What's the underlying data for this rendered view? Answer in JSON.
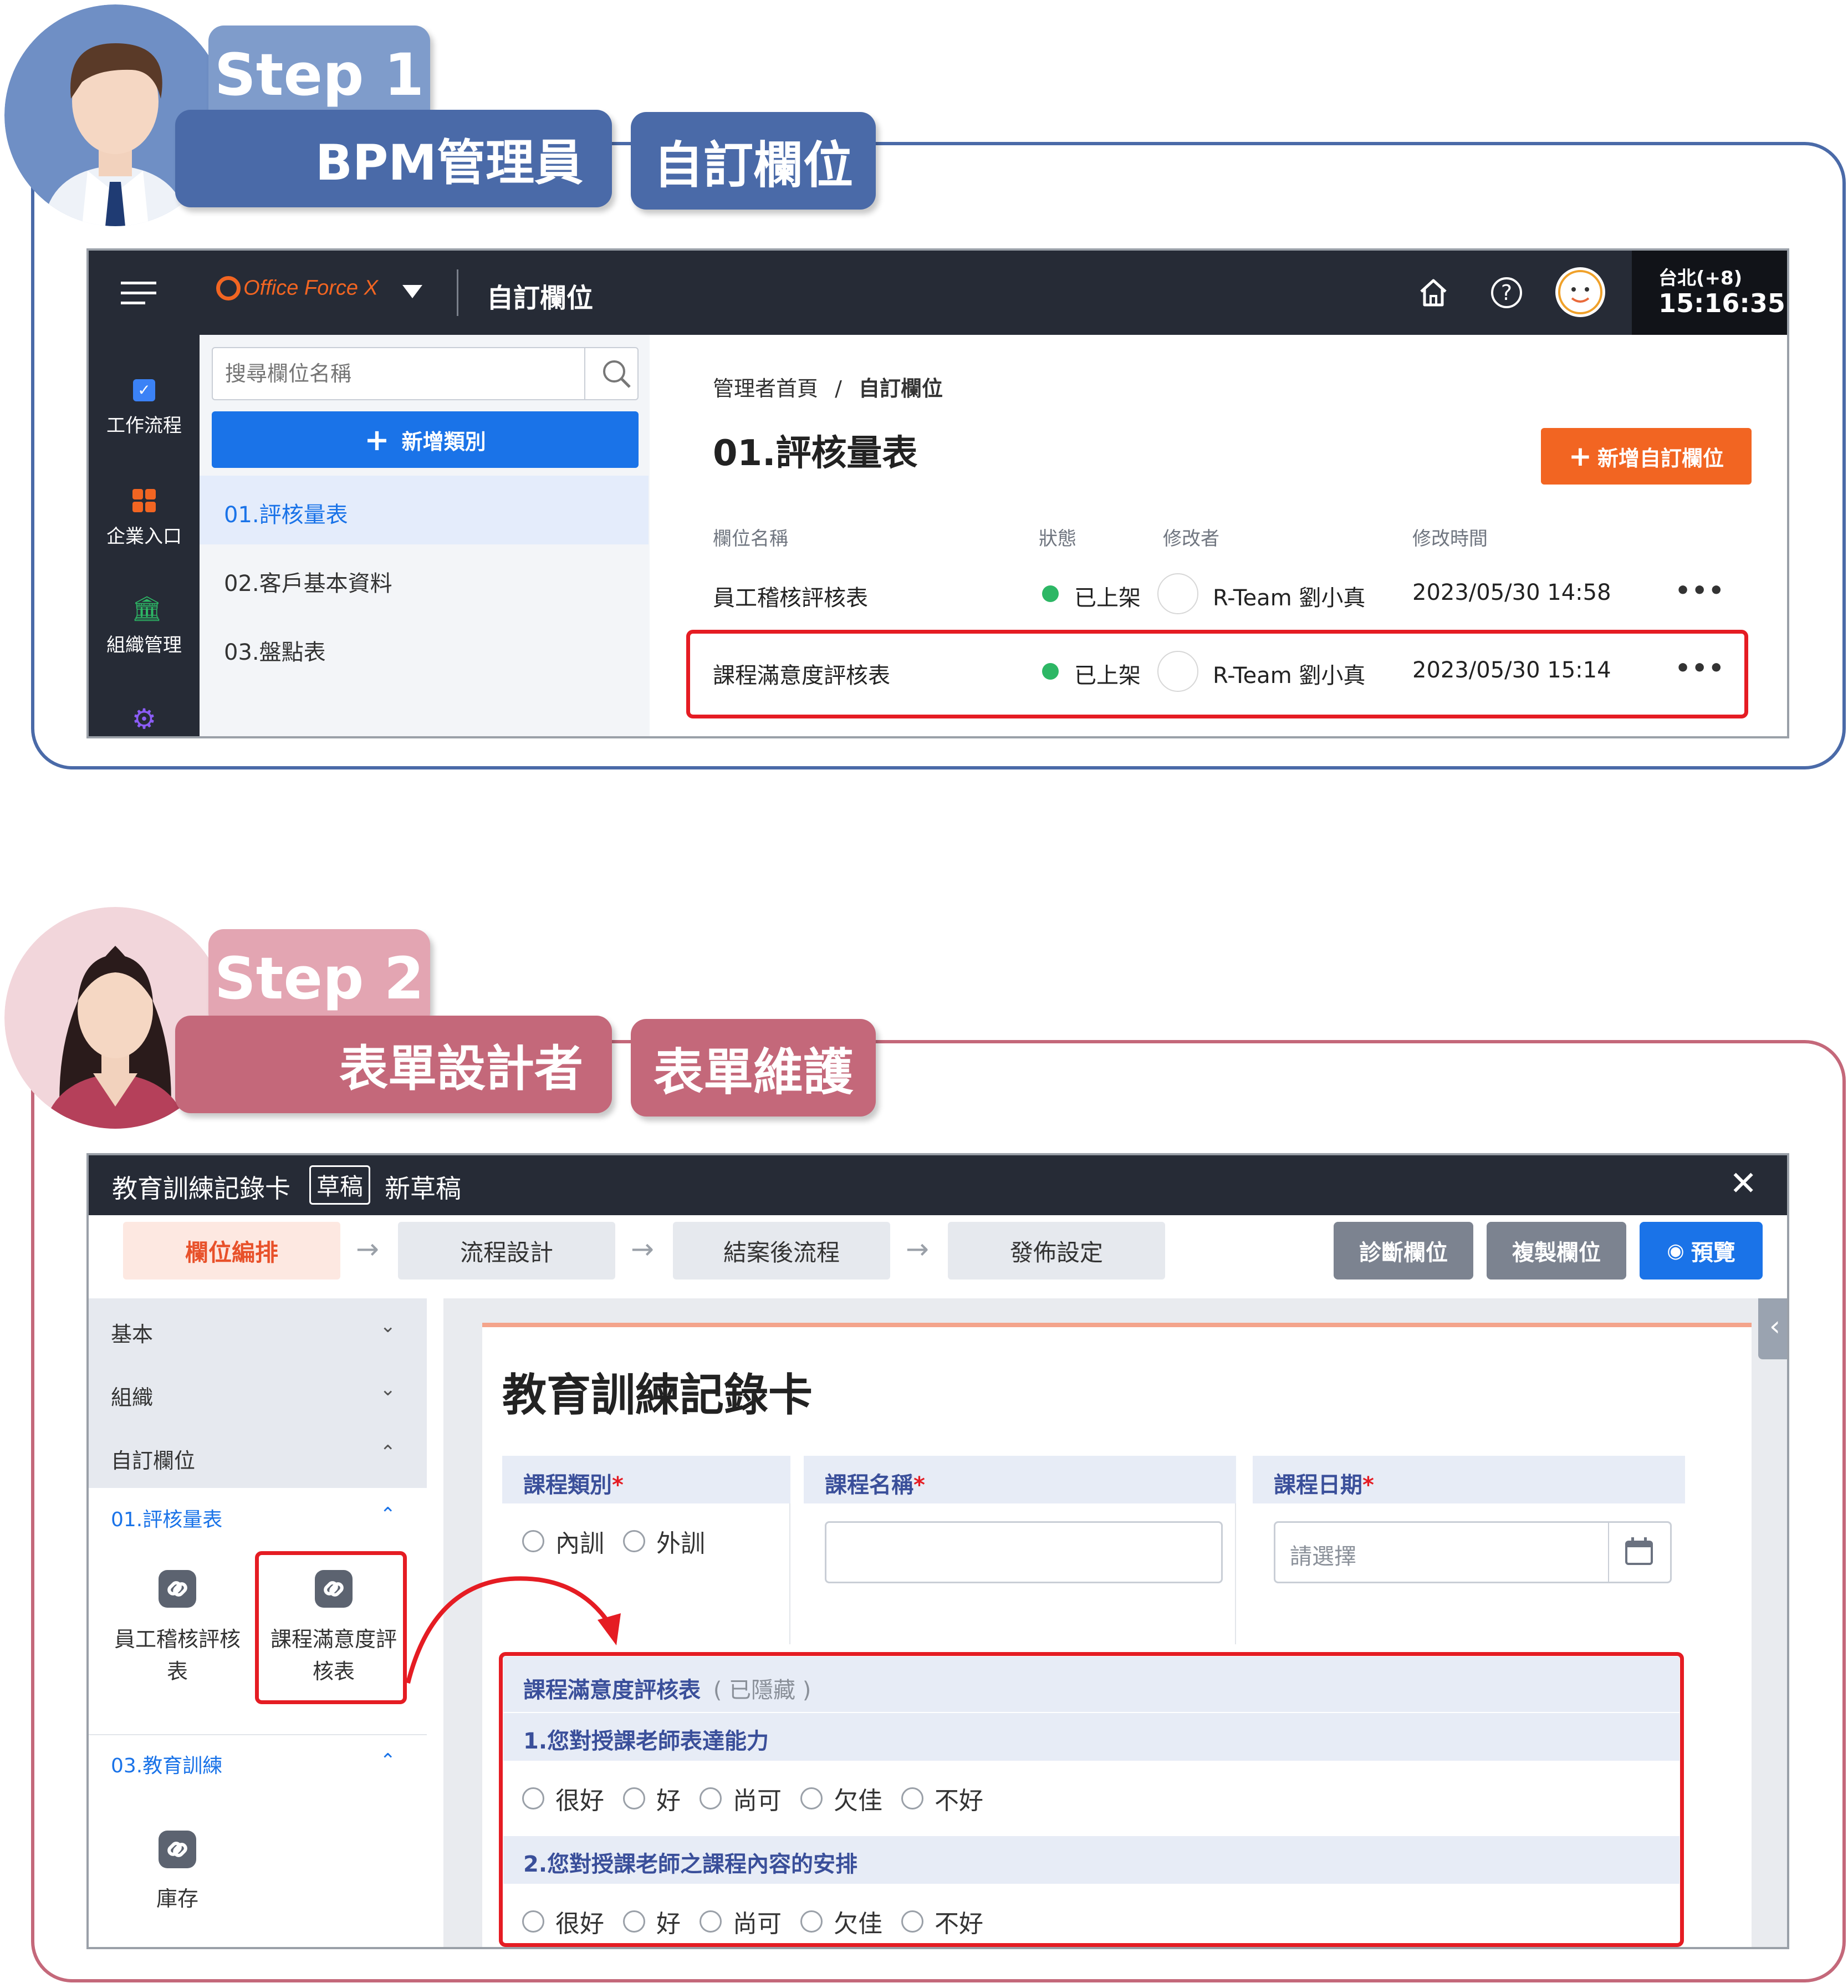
{
  "colors": {
    "step1": "#4a6aa8",
    "step1_light": "#7f9ccb",
    "step2": "#c4687a",
    "step2_light": "#e3a5b2",
    "accent_orange": "#f26522",
    "accent_blue": "#1a73e8",
    "highlight_red": "#e51c23"
  },
  "step1": {
    "step_label": "Step 1",
    "role": "BPM管理員",
    "feature": "自訂欄位",
    "app": {
      "logo_text": "Office Force X",
      "page_title": "自訂欄位",
      "timezone": "台北(+8)",
      "time": "15:16:35",
      "icons": [
        "menu-icon",
        "home-icon",
        "help-icon",
        "user-avatar"
      ],
      "sidebar": [
        {
          "label": "工作流程",
          "icon": "workflow-icon"
        },
        {
          "label": "企業入口",
          "icon": "portal-icon"
        },
        {
          "label": "組織管理",
          "icon": "org-icon"
        },
        {
          "label": "",
          "icon": "settings-icon"
        }
      ],
      "search_placeholder": "搜尋欄位名稱",
      "add_category": "新增類別",
      "categories": [
        "01.評核量表",
        "02.客戶基本資料",
        "03.盤點表"
      ],
      "breadcrumb": [
        "管理者首頁",
        "自訂欄位"
      ],
      "breadcrumb_sep": "/",
      "heading": "01.評核量表",
      "add_field_button": "新增自訂欄位",
      "table": {
        "headers": [
          "欄位名稱",
          "狀態",
          "修改者",
          "修改時間"
        ],
        "rows": [
          {
            "name": "員工稽核評核表",
            "status": "已上架",
            "editor": "R-Team 劉小真",
            "time": "2023/05/30 14:58",
            "more": "•••"
          },
          {
            "name": "課程滿意度評核表",
            "status": "已上架",
            "editor": "R-Team 劉小真",
            "time": "2023/05/30 15:14",
            "more": "•••"
          }
        ]
      }
    }
  },
  "step2": {
    "step_label": "Step 2",
    "role": "表單設計者",
    "feature": "表單維護",
    "app": {
      "form_name": "教育訓練記錄卡",
      "draft_badge": "草稿",
      "draft_name": "新草稿",
      "close": "✕",
      "steps": [
        "欄位編排",
        "流程設計",
        "結案後流程",
        "發佈設定"
      ],
      "step_arrow": "→",
      "tool_buttons": [
        "診斷欄位",
        "複製欄位",
        "預覽"
      ],
      "collapse_icon": "‹",
      "accordion": [
        "基本",
        "組織",
        "自訂欄位"
      ],
      "groups": [
        {
          "label": "01.評核量表",
          "items": [
            "員工稽核評核表",
            "課程滿意度評核表"
          ]
        },
        {
          "label": "03.教育訓練",
          "items": [
            "庫存"
          ]
        }
      ],
      "form": {
        "title": "教育訓練記錄卡",
        "fields": [
          {
            "label": "課程類別",
            "required": "*",
            "options": [
              "內訓",
              "外訓"
            ]
          },
          {
            "label": "課程名稱",
            "required": "*",
            "value": ""
          },
          {
            "label": "課程日期",
            "required": "*",
            "placeholder": "請選擇"
          }
        ],
        "section": {
          "title": "課程滿意度評核表",
          "hidden_note": "( 已隱藏 )",
          "questions": [
            {
              "text": "1.您對授課老師表達能力",
              "options": [
                "很好",
                "好",
                "尚可",
                "欠佳",
                "不好"
              ]
            },
            {
              "text": "2.您對授課老師之課程內容的安排",
              "options": [
                "很好",
                "好",
                "尚可",
                "欠佳",
                "不好"
              ]
            }
          ]
        }
      }
    }
  }
}
